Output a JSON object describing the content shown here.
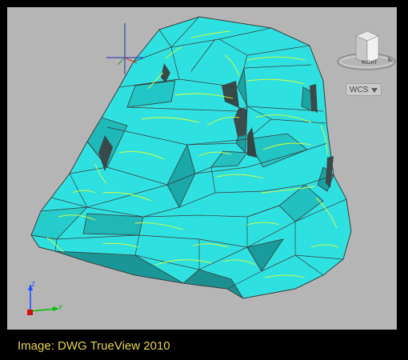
{
  "viewport": {
    "background_color": "#b5b5b5",
    "model_color": "#2ee0e0",
    "edge_color": "#4a4a4a",
    "isoline_color": "#d8ff3a",
    "crosshair_color": "#2233bb"
  },
  "viewcube": {
    "face_label": "RIGHT",
    "icon": "view-cube-icon"
  },
  "wcs_menu": {
    "label": "WCS",
    "icon": "chevron-down-icon"
  },
  "ucs_icon": {
    "z_label": "Z",
    "y_label": "Y"
  },
  "caption": {
    "text": "Image: DWG TrueView 2010",
    "color": "#e6d24a"
  }
}
